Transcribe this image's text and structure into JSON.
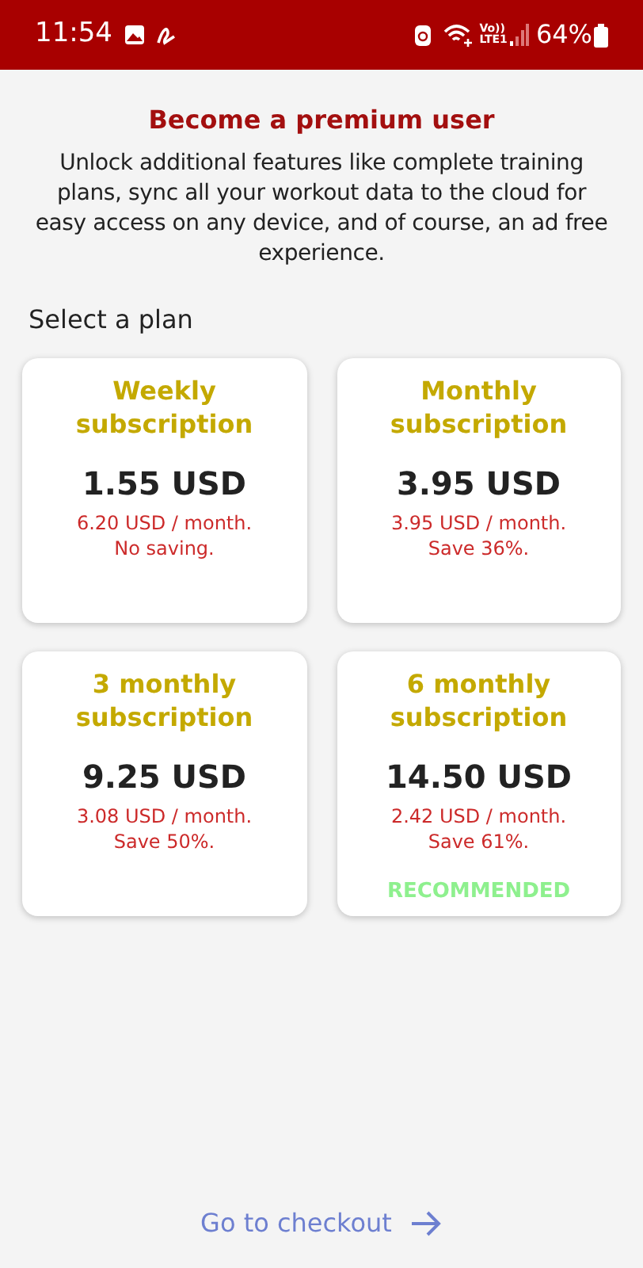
{
  "status_bar": {
    "time": "11:54",
    "network_top": "Vo))",
    "network_bottom": "LTE1",
    "battery": "64%"
  },
  "title": "Become a premium user",
  "description": "Unlock additional features like complete training plans, sync all your workout data to the cloud for easy access on any device, and of course, an ad free experience.",
  "section_label": "Select a plan",
  "plans": [
    {
      "name": "Weekly subscription",
      "price": "1.55 USD",
      "monthly": "6.20 USD / month.",
      "saving": "No saving."
    },
    {
      "name": "Monthly subscription",
      "price": "3.95 USD",
      "monthly": "3.95 USD / month.",
      "saving": "Save 36%."
    },
    {
      "name": "3 monthly subscription",
      "price": "9.25 USD",
      "monthly": "3.08 USD / month.",
      "saving": "Save 50%."
    },
    {
      "name": "6 monthly subscription",
      "price": "14.50 USD",
      "monthly": "2.42 USD / month.",
      "saving": "Save 61%.",
      "badge": "RECOMMENDED"
    }
  ],
  "checkout": "Go to checkout"
}
